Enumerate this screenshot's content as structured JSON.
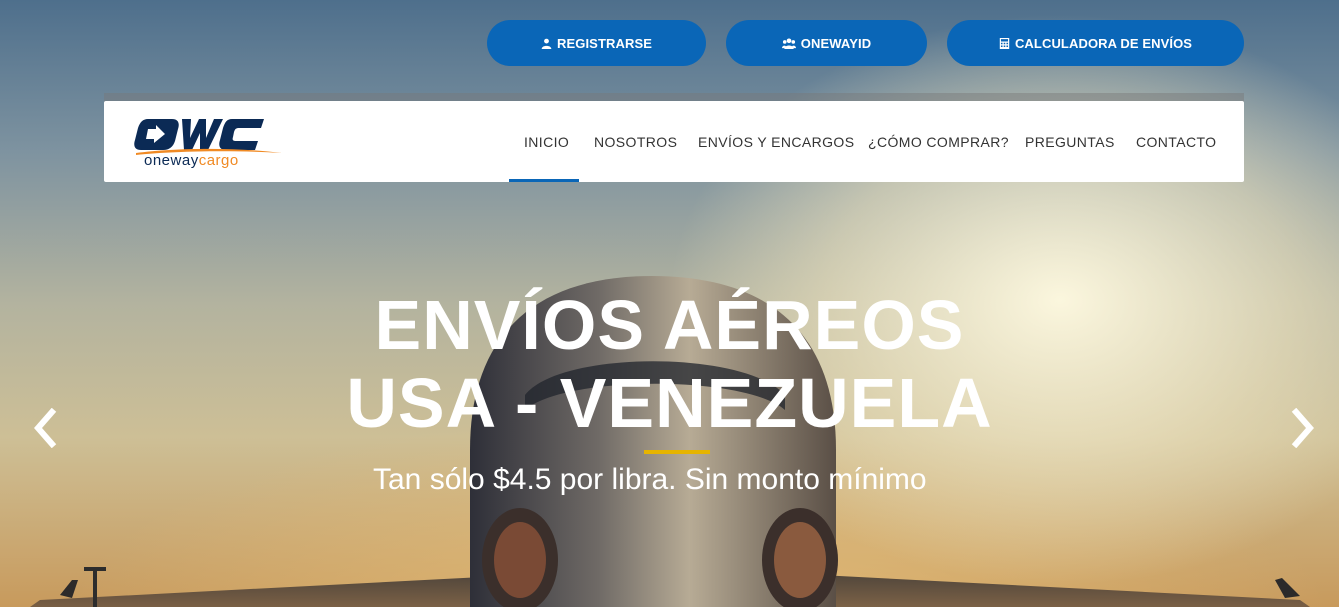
{
  "top_buttons": {
    "register": {
      "label": "REGISTRARSE",
      "icon": "user-icon"
    },
    "onewayid": {
      "label": "ONEWAYID",
      "icon": "users-icon"
    },
    "calculator": {
      "label": "CALCULADORA DE ENVÍOS",
      "icon": "calculator-icon"
    }
  },
  "logo": {
    "mark": "OWC",
    "text_one": "oneway",
    "text_two": "cargo"
  },
  "nav": {
    "items": [
      {
        "label": "INICIO",
        "active": true
      },
      {
        "label": "NOSOTROS",
        "active": false
      },
      {
        "label": "ENVÍOS Y ENCARGOS",
        "active": false
      },
      {
        "label": "¿CÓMO COMPRAR?",
        "active": false
      },
      {
        "label": "PREGUNTAS",
        "active": false
      },
      {
        "label": "CONTACTO",
        "active": false
      }
    ]
  },
  "slide": {
    "headline_line1": "ENVÍOS AÉREOS",
    "headline_line2": "USA - VENEZUELA",
    "subheadline": "Tan sólo $4.5 por libra. Sin monto mínimo"
  },
  "carousel": {
    "prev_icon": "chevron-left-icon",
    "next_icon": "chevron-right-icon"
  },
  "colors": {
    "primary": "#0a66b7",
    "accent_line": "#e6b400",
    "logo_navy": "#0b2a55",
    "logo_orange": "#f08a24"
  }
}
